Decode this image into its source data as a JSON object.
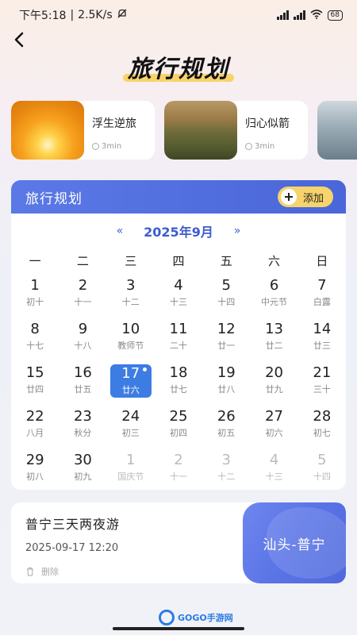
{
  "status_bar": {
    "time": "下午5:18",
    "speed": "2.5K/s",
    "battery": "68"
  },
  "header": {
    "title": "旅行规划"
  },
  "stories": [
    {
      "name": "浮生逆旅",
      "duration": "3min"
    },
    {
      "name": "归心似箭",
      "duration": "3min"
    }
  ],
  "planner": {
    "title": "旅行规划",
    "add_label": "添加",
    "month_label": "2025年9月",
    "prev_arrow": "«",
    "next_arrow": "»",
    "weekdays": [
      "一",
      "二",
      "三",
      "四",
      "五",
      "六",
      "日"
    ],
    "days": [
      {
        "num": "1",
        "lunar": "初十"
      },
      {
        "num": "2",
        "lunar": "十一"
      },
      {
        "num": "3",
        "lunar": "十二"
      },
      {
        "num": "4",
        "lunar": "十三"
      },
      {
        "num": "5",
        "lunar": "十四"
      },
      {
        "num": "6",
        "lunar": "中元节"
      },
      {
        "num": "7",
        "lunar": "白露"
      },
      {
        "num": "8",
        "lunar": "十七"
      },
      {
        "num": "9",
        "lunar": "十八"
      },
      {
        "num": "10",
        "lunar": "教师节"
      },
      {
        "num": "11",
        "lunar": "二十"
      },
      {
        "num": "12",
        "lunar": "廿一"
      },
      {
        "num": "13",
        "lunar": "廿二"
      },
      {
        "num": "14",
        "lunar": "廿三"
      },
      {
        "num": "15",
        "lunar": "廿四"
      },
      {
        "num": "16",
        "lunar": "廿五"
      },
      {
        "num": "17",
        "lunar": "廿六",
        "selected": true
      },
      {
        "num": "18",
        "lunar": "廿七"
      },
      {
        "num": "19",
        "lunar": "廿八"
      },
      {
        "num": "20",
        "lunar": "廿九"
      },
      {
        "num": "21",
        "lunar": "三十"
      },
      {
        "num": "22",
        "lunar": "八月"
      },
      {
        "num": "23",
        "lunar": "秋分"
      },
      {
        "num": "24",
        "lunar": "初三"
      },
      {
        "num": "25",
        "lunar": "初四"
      },
      {
        "num": "26",
        "lunar": "初五"
      },
      {
        "num": "27",
        "lunar": "初六"
      },
      {
        "num": "28",
        "lunar": "初七"
      },
      {
        "num": "29",
        "lunar": "初八"
      },
      {
        "num": "30",
        "lunar": "初九"
      },
      {
        "num": "1",
        "lunar": "国庆节",
        "other": true
      },
      {
        "num": "2",
        "lunar": "十一",
        "other": true
      },
      {
        "num": "3",
        "lunar": "十二",
        "other": true
      },
      {
        "num": "4",
        "lunar": "十三",
        "other": true
      },
      {
        "num": "5",
        "lunar": "十四",
        "other": true
      }
    ]
  },
  "trip": {
    "name": "普宁三天两夜游",
    "datetime": "2025-09-17 12:20",
    "delete_label": "删除",
    "route": "汕头-普宁"
  },
  "watermark": {
    "text": "GOGO手游网"
  },
  "colors": {
    "accent": "#4a66d8",
    "selected": "#3d7de3",
    "add_button": "#f6d36b",
    "title_highlight": "#f7d36a"
  }
}
